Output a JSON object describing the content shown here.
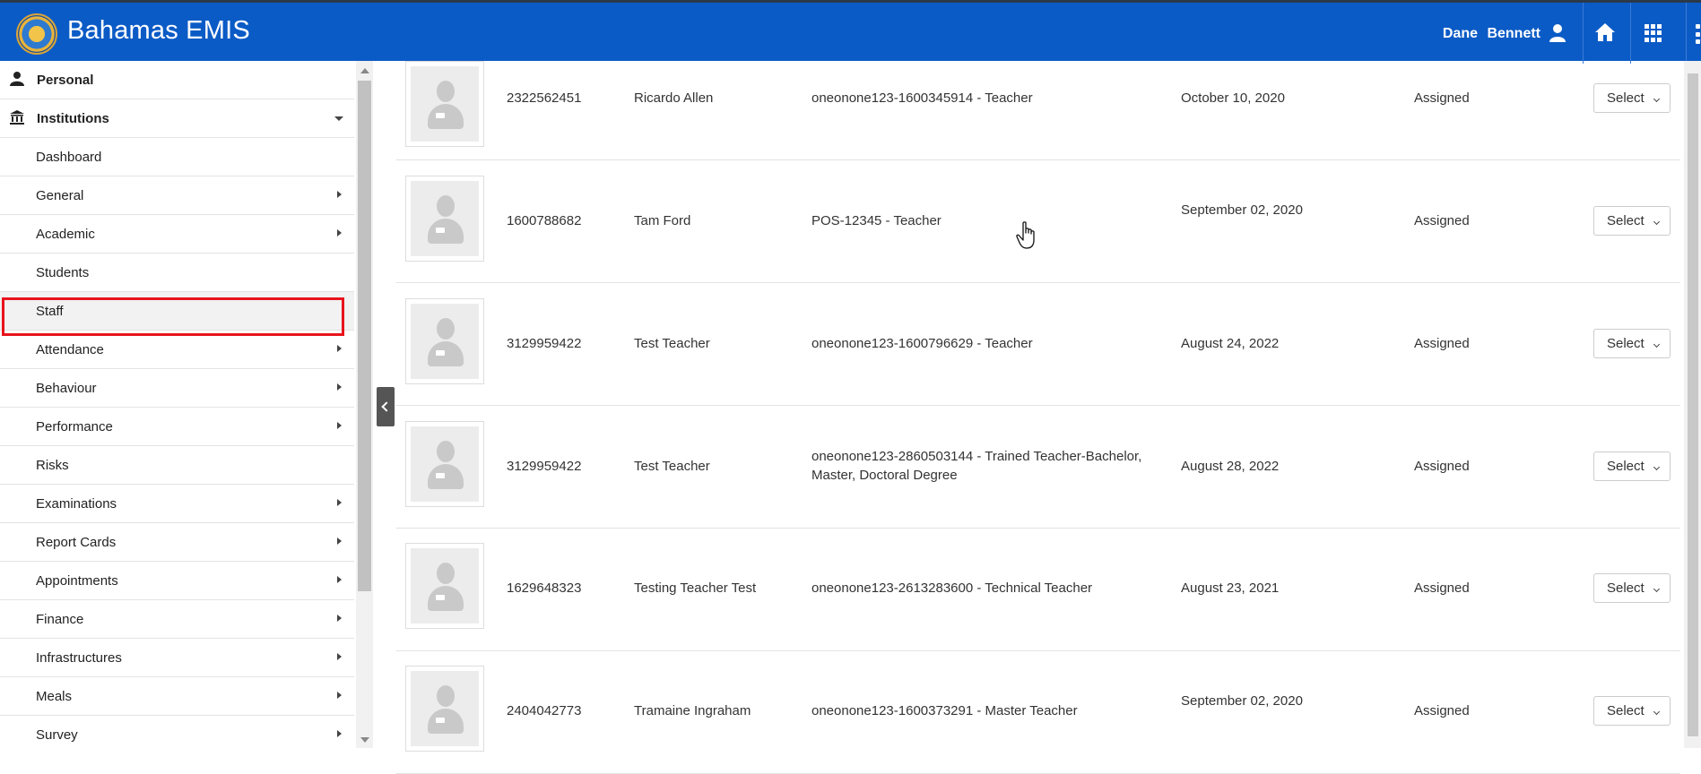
{
  "header": {
    "brand": "Bahamas EMIS",
    "user_name": "Dane  Bennett",
    "colors": {
      "bar": "#0b5bc6",
      "highlight": "#e8141c"
    }
  },
  "sidebar": {
    "items": [
      {
        "label": "Personal",
        "icon": "user-icon",
        "kind": "top"
      },
      {
        "label": "Institutions",
        "icon": "bank-icon",
        "kind": "top-expanded"
      },
      {
        "label": "Dashboard",
        "arrow": false
      },
      {
        "label": "General",
        "arrow": true
      },
      {
        "label": "Academic",
        "arrow": true
      },
      {
        "label": "Students",
        "arrow": false
      },
      {
        "label": "Staff",
        "arrow": false,
        "active": true
      },
      {
        "label": "Attendance",
        "arrow": true
      },
      {
        "label": "Behaviour",
        "arrow": true
      },
      {
        "label": "Performance",
        "arrow": true
      },
      {
        "label": "Risks",
        "arrow": false
      },
      {
        "label": "Examinations",
        "arrow": true
      },
      {
        "label": "Report Cards",
        "arrow": true
      },
      {
        "label": "Appointments",
        "arrow": true
      },
      {
        "label": "Finance",
        "arrow": true
      },
      {
        "label": "Infrastructures",
        "arrow": true
      },
      {
        "label": "Meals",
        "arrow": true
      },
      {
        "label": "Survey",
        "arrow": true
      }
    ]
  },
  "staff": {
    "select_label": "Select",
    "rows": [
      {
        "id": "2322562451",
        "name": "Ricardo Allen",
        "position": "oneonone123-1600345914 - Teacher",
        "date": "October 10, 2020",
        "status": "Assigned"
      },
      {
        "id": "1600788682",
        "name": "Tam Ford",
        "position": "POS-12345 - Teacher",
        "date": "September 02, 2020",
        "status": "Assigned"
      },
      {
        "id": "3129959422",
        "name": "Test Teacher",
        "position": "oneonone123-1600796629 - Teacher",
        "date": "August 24, 2022",
        "status": "Assigned"
      },
      {
        "id": "3129959422",
        "name": "Test Teacher",
        "position": "oneonone123-2860503144 - Trained Teacher-Bachelor, Master, Doctoral Degree",
        "date": "August 28, 2022",
        "status": "Assigned"
      },
      {
        "id": "1629648323",
        "name": "Testing Teacher Test",
        "position": "oneonone123-2613283600 - Technical Teacher",
        "date": "August 23, 2021",
        "status": "Assigned"
      },
      {
        "id": "2404042773",
        "name": "Tramaine Ingraham",
        "position": "oneonone123-1600373291 - Master Teacher",
        "date": "September 02, 2020",
        "status": "Assigned"
      }
    ]
  }
}
